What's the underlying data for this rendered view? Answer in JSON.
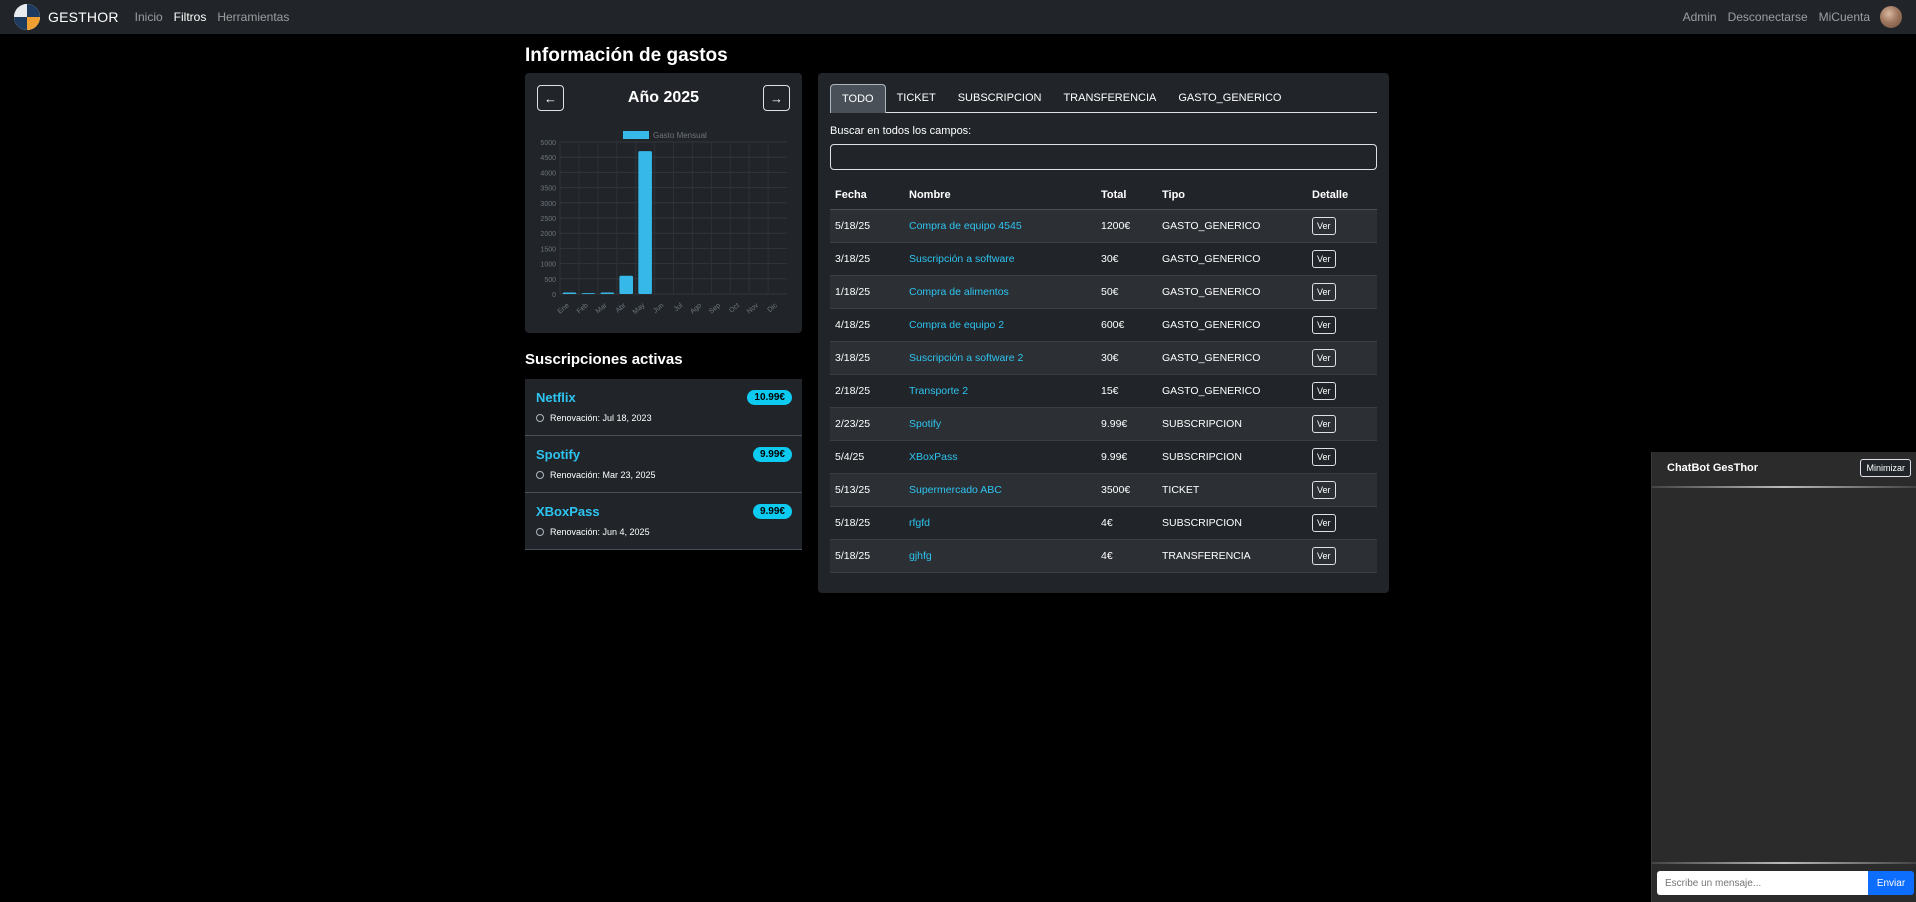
{
  "nav": {
    "brand": "GESTHOR",
    "links": [
      "Inicio",
      "Filtros",
      "Herramientas"
    ],
    "right_links": [
      "Admin",
      "Desconectarse",
      "MiCuenta"
    ]
  },
  "page": {
    "title": "Información de gastos",
    "subs_title": "Suscripciones activas"
  },
  "chart_header": {
    "prev": "←",
    "next": "→",
    "year_title": "Año 2025"
  },
  "chart_data": {
    "type": "bar",
    "categories": [
      "Ene",
      "Feb",
      "Mar",
      "Abr",
      "May",
      "Jun",
      "Jul",
      "Ago",
      "Sep",
      "Oct",
      "Nov",
      "Dic"
    ],
    "series": [
      {
        "name": "Gasto Mensual",
        "values": [
          50,
          30,
          50,
          600,
          4700,
          0,
          0,
          0,
          0,
          0,
          0,
          0
        ],
        "color": "#36b9e8"
      }
    ],
    "yticks": [
      0,
      500,
      1000,
      1500,
      2000,
      2500,
      3000,
      3500,
      4000,
      4500,
      5000
    ],
    "ylim": [
      0,
      5000
    ],
    "legend": "top"
  },
  "subscriptions": [
    {
      "name": "Netflix",
      "price": "10.99€",
      "renewal": "Renovación: Jul 18, 2023"
    },
    {
      "name": "Spotify",
      "price": "9.99€",
      "renewal": "Renovación: Mar 23, 2025"
    },
    {
      "name": "XBoxPass",
      "price": "9.99€",
      "renewal": "Renovación: Jun 4, 2025"
    }
  ],
  "tabs": [
    "TODO",
    "TICKET",
    "SUBSCRIPCION",
    "TRANSFERENCIA",
    "GASTO_GENERICO"
  ],
  "search": {
    "label": "Buscar en todos los campos:",
    "value": ""
  },
  "table": {
    "headers": [
      "Fecha",
      "Nombre",
      "Total",
      "Tipo",
      "Detalle"
    ],
    "button_label": "Ver",
    "rows": [
      [
        "5/18/25",
        "Compra de equipo 4545",
        "1200€",
        "GASTO_GENERICO"
      ],
      [
        "3/18/25",
        "Suscripción a software",
        "30€",
        "GASTO_GENERICO"
      ],
      [
        "1/18/25",
        "Compra de alimentos",
        "50€",
        "GASTO_GENERICO"
      ],
      [
        "4/18/25",
        "Compra de equipo 2",
        "600€",
        "GASTO_GENERICO"
      ],
      [
        "3/18/25",
        "Suscripción a software 2",
        "30€",
        "GASTO_GENERICO"
      ],
      [
        "2/18/25",
        "Transporte 2",
        "15€",
        "GASTO_GENERICO"
      ],
      [
        "2/23/25",
        "Spotify",
        "9.99€",
        "SUBSCRIPCION"
      ],
      [
        "5/4/25",
        "XBoxPass",
        "9.99€",
        "SUBSCRIPCION"
      ],
      [
        "5/13/25",
        "Supermercado ABC",
        "3500€",
        "TICKET"
      ],
      [
        "5/18/25",
        "rfgfd",
        "4€",
        "SUBSCRIPCION"
      ],
      [
        "5/18/25",
        "gjhfg",
        "4€",
        "TRANSFERENCIA"
      ]
    ]
  },
  "chatbot": {
    "title": "ChatBot GesThor",
    "minimize": "Minimizar",
    "placeholder": "Escribe un mensaje...",
    "send": "Enviar"
  }
}
